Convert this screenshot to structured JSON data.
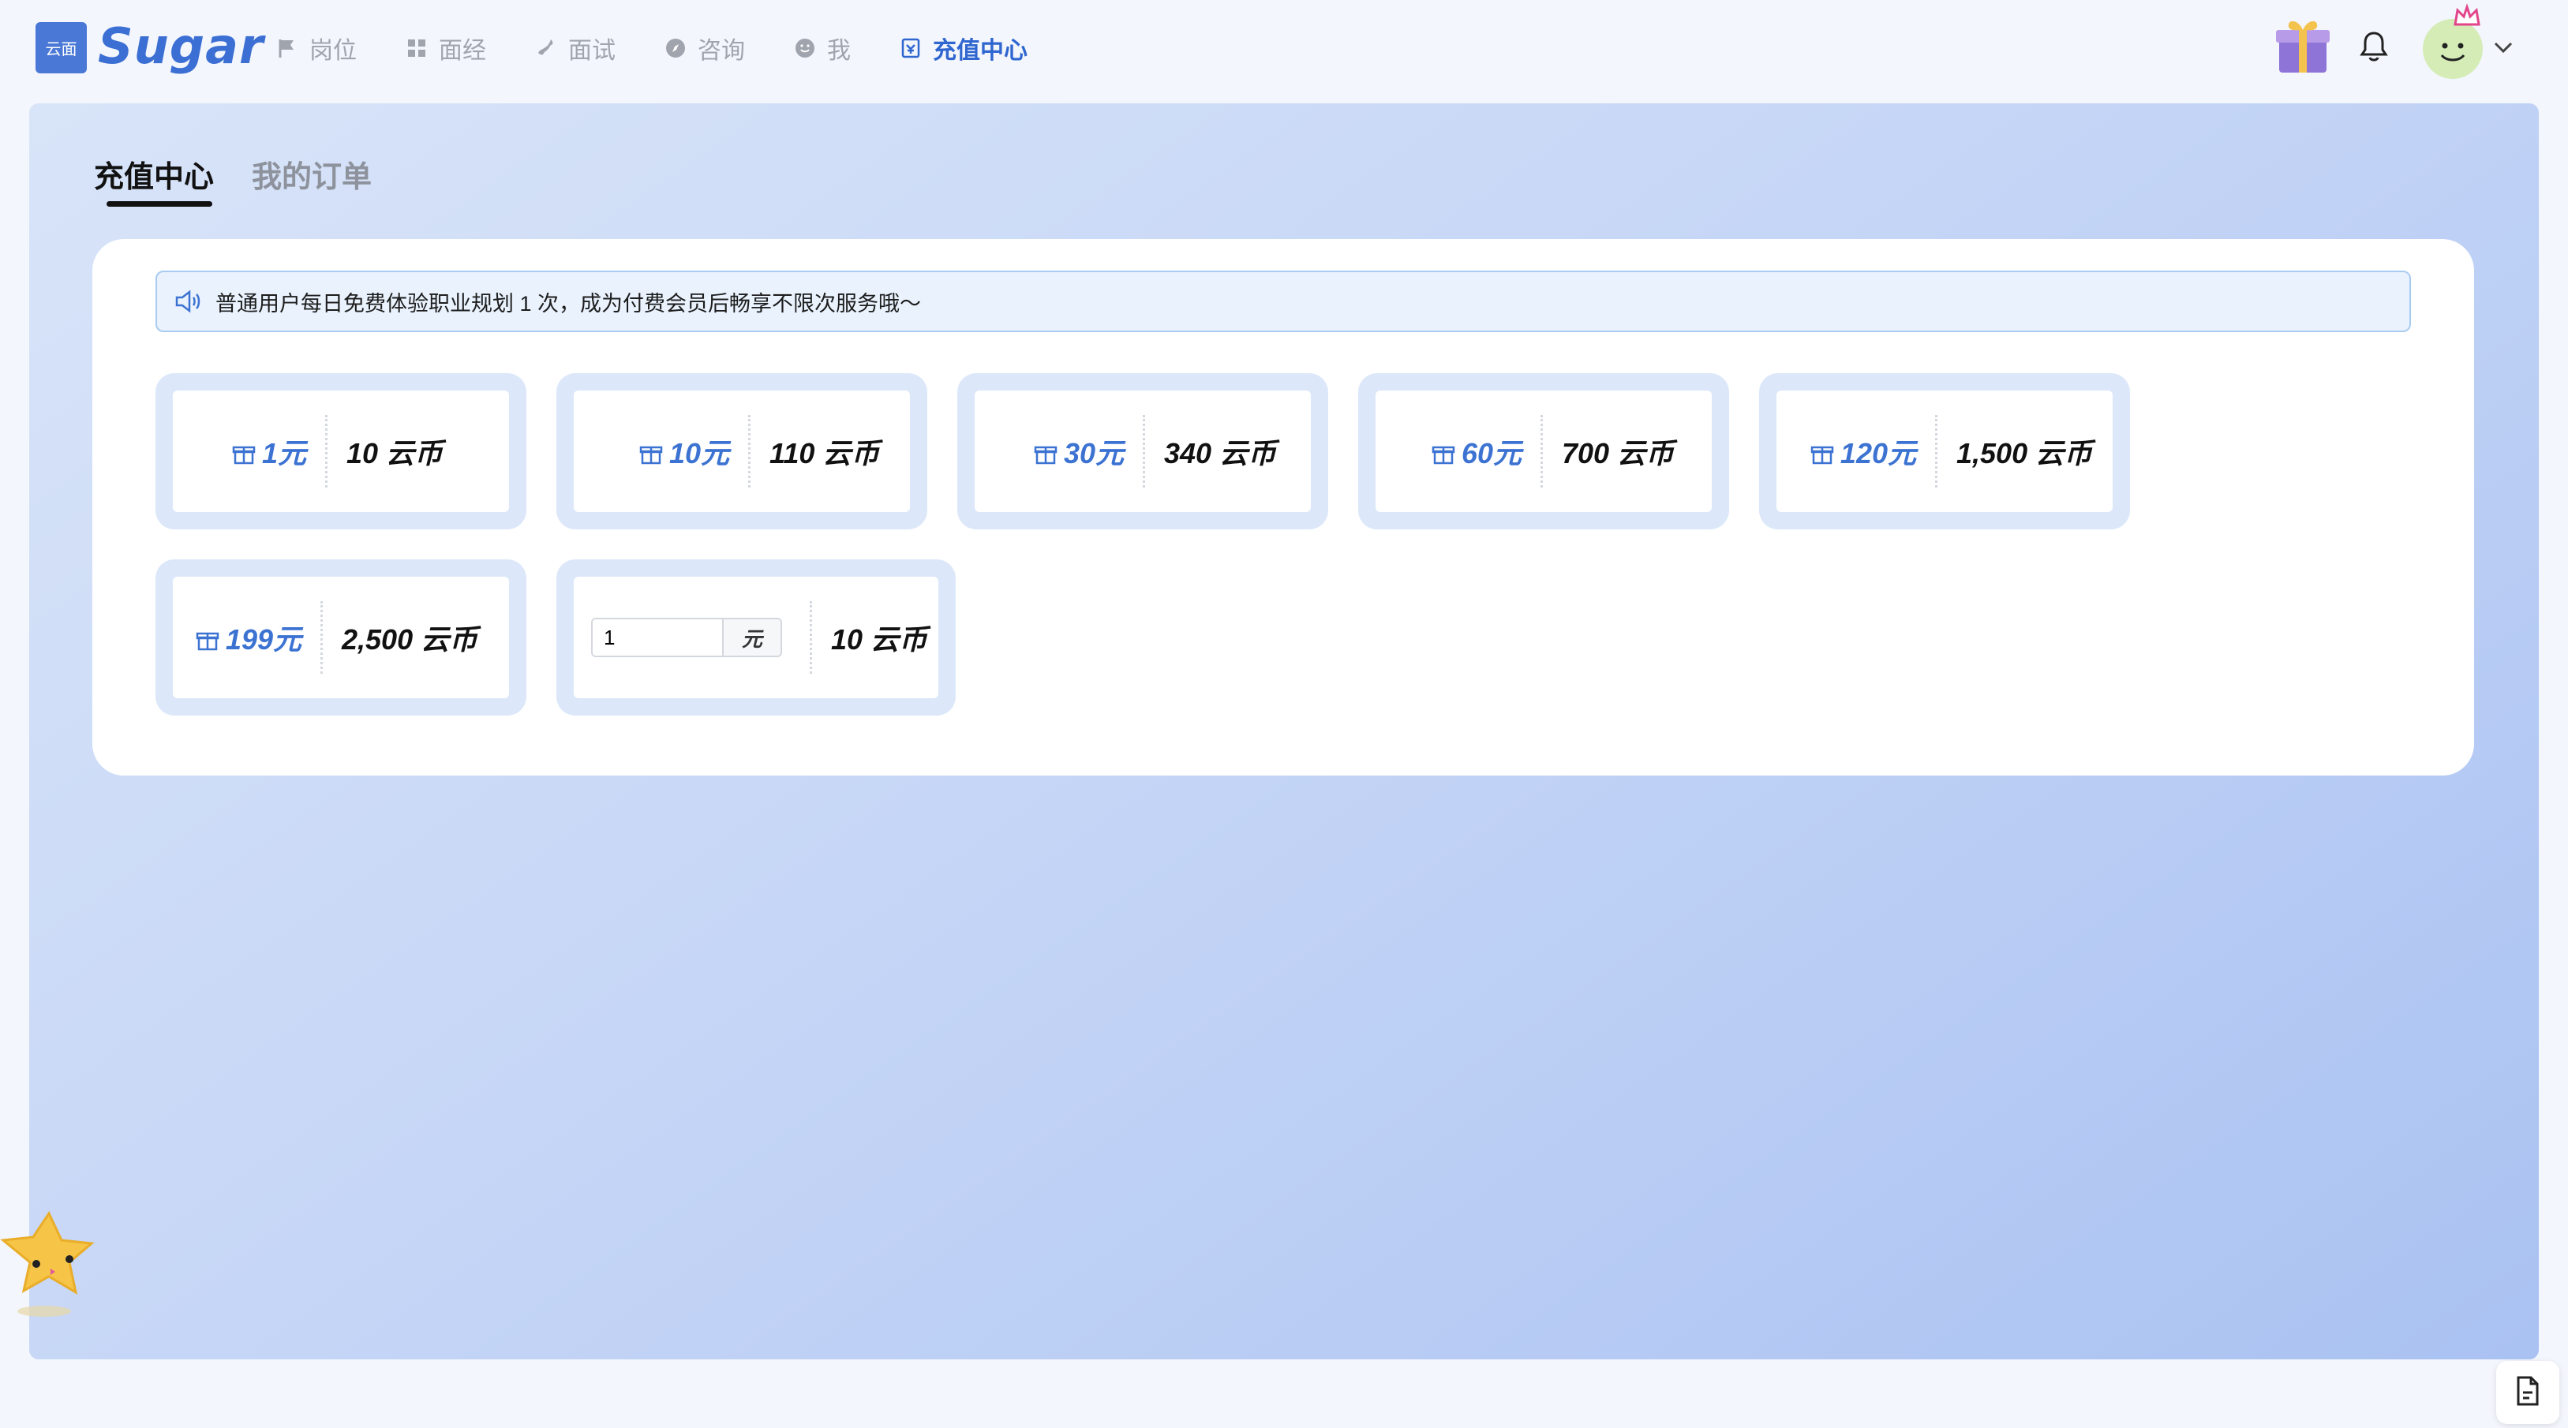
{
  "brand": {
    "logo_box_text": "云面",
    "name": "Sugar"
  },
  "nav": [
    {
      "label": "岗位",
      "icon": "flag-icon"
    },
    {
      "label": "面经",
      "icon": "grid-icon"
    },
    {
      "label": "面试",
      "icon": "phone-icon"
    },
    {
      "label": "咨询",
      "icon": "compass-icon"
    },
    {
      "label": "我",
      "icon": "smile-icon"
    },
    {
      "label": "充值中心",
      "icon": "wallet-icon",
      "active": true
    }
  ],
  "header_right": {
    "gift_icon": "gift-icon",
    "bell_icon": "bell-icon",
    "avatar_icon": "avatar-icon",
    "chevron_icon": "chevron-down-icon"
  },
  "tabs": [
    {
      "label": "充值中心",
      "active": true
    },
    {
      "label": "我的订单",
      "active": false
    }
  ],
  "notice": {
    "text": "普通用户每日免费体验职业规划 1 次，成为付费会员后畅享不限次服务哦～"
  },
  "packages": [
    {
      "price": "1元",
      "coins": "10 云币"
    },
    {
      "price": "10元",
      "coins": "110 云币"
    },
    {
      "price": "30元",
      "coins": "340 云币"
    },
    {
      "price": "60元",
      "coins": "700 云币"
    },
    {
      "price": "120元",
      "coins": "1,500 云币"
    },
    {
      "price": "199元",
      "coins": "2,500 云币"
    }
  ],
  "custom": {
    "value": "1",
    "unit": "元",
    "coins": "10 云币"
  },
  "colors": {
    "accent": "#3c73d2",
    "panel_start": "#d8e4f8",
    "panel_end": "#aac2f2",
    "package_frame": "#dce8fa"
  }
}
